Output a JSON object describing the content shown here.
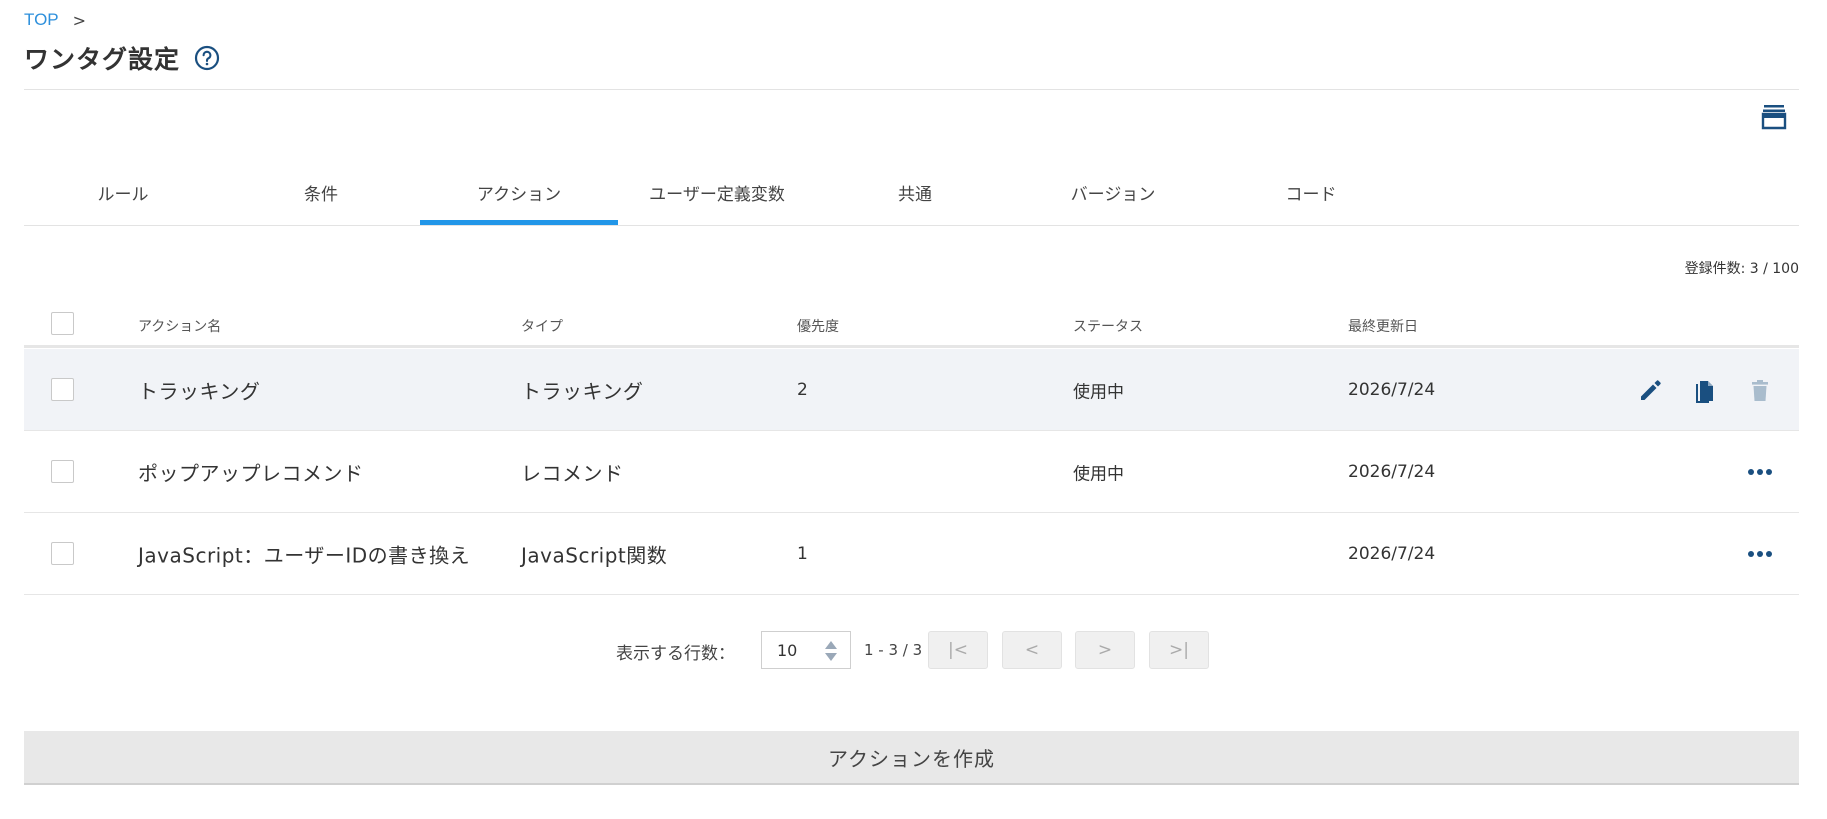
{
  "breadcrumb": {
    "top": "TOP",
    "separator": ">"
  },
  "page_title": "ワンタグ設定",
  "tabs": [
    {
      "label": "ルール",
      "active": false
    },
    {
      "label": "条件",
      "active": false
    },
    {
      "label": "アクション",
      "active": true
    },
    {
      "label": "ユーザー定義変数",
      "active": false
    },
    {
      "label": "共通",
      "active": false
    },
    {
      "label": "バージョン",
      "active": false
    },
    {
      "label": "コード",
      "active": false
    }
  ],
  "record_count": "登録件数: 3 / 100",
  "table": {
    "headers": {
      "name": "アクション名",
      "type": "タイプ",
      "priority": "優先度",
      "status": "ステータス",
      "updated": "最終更新日"
    },
    "rows": [
      {
        "name": "トラッキング",
        "type": "トラッキング",
        "priority": "2",
        "status": "使用中",
        "updated": "2026/7/24"
      },
      {
        "name": "ポップアップレコメンド",
        "type": "レコメンド",
        "priority": "",
        "status": "使用中",
        "updated": "2026/7/24"
      },
      {
        "name": "JavaScript：ユーザーIDの書き換え",
        "type": "JavaScript関数",
        "priority": "1",
        "status": "",
        "updated": "2026/7/24"
      }
    ]
  },
  "pagination": {
    "rows_label": "表示する行数：",
    "rows_value": "10",
    "range": "1 - 3 / 3",
    "first": "|<",
    "prev": "<",
    "next": ">",
    "last": ">|"
  },
  "create_button": "アクションを作成",
  "colors": {
    "accent": "#2196e8",
    "link": "#2e90dc",
    "icon": "#1a4f80",
    "icon_disabled": "#a9bccd"
  },
  "icons": {
    "help": "help-circle-icon",
    "archive": "archive-icon",
    "edit": "pencil-icon",
    "copy": "copy-icon",
    "delete": "trash-icon",
    "more": "more-horizontal-icon"
  }
}
